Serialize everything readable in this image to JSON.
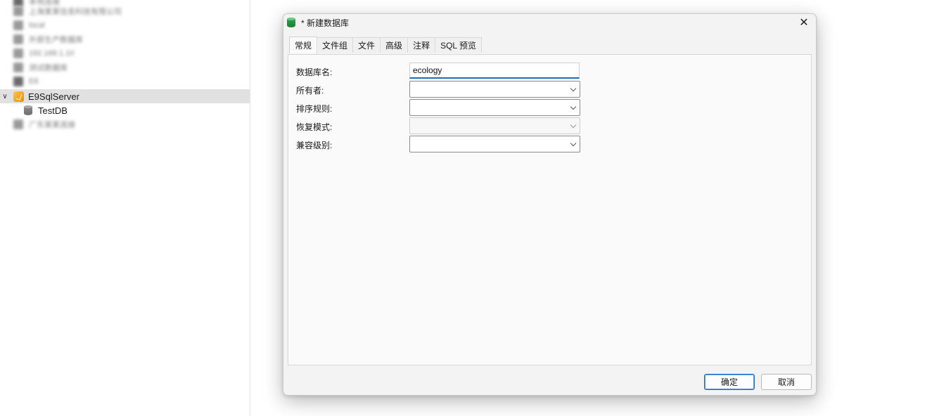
{
  "sidebar": {
    "server_name": "E9SqlServer",
    "database_name": "TestDB",
    "blurred_rows": [
      {
        "label": "本地连接",
        "icon": "connection-icon"
      },
      {
        "label": "上海某某信息科技有限公司",
        "icon": "connection-icon"
      },
      {
        "label": "local",
        "icon": "connection-icon"
      },
      {
        "label": "外部生产数据库",
        "icon": "connection-icon"
      },
      {
        "label": "192.168.1.10",
        "icon": "connection-icon"
      },
      {
        "label": "测试数据库",
        "icon": "connection-icon"
      },
      {
        "label": "E8",
        "icon": "connection-icon"
      },
      {
        "label": "广东某某连接",
        "icon": "connection-icon"
      }
    ]
  },
  "dialog": {
    "title": "* 新建数据库",
    "close_label": "✕",
    "tabs": [
      {
        "label": "常规",
        "active": true
      },
      {
        "label": "文件组",
        "active": false
      },
      {
        "label": "文件",
        "active": false
      },
      {
        "label": "高级",
        "active": false
      },
      {
        "label": "注释",
        "active": false
      },
      {
        "label": "SQL 预览",
        "active": false
      }
    ],
    "fields": {
      "db_name_label": "数据库名:",
      "db_name_value": "ecology",
      "owner_label": "所有者:",
      "owner_value": "",
      "collation_label": "排序规则:",
      "collation_value": "",
      "recovery_label": "恢复模式:",
      "recovery_value": "",
      "compat_label": "兼容级别:",
      "compat_value": ""
    },
    "buttons": {
      "ok": "确定",
      "cancel": "取消"
    }
  },
  "colors": {
    "accent": "#1e6fb8",
    "selection": "#e1e1e1",
    "server_icon": "#f6a41d",
    "db_icon_title": "#2ea44f"
  }
}
